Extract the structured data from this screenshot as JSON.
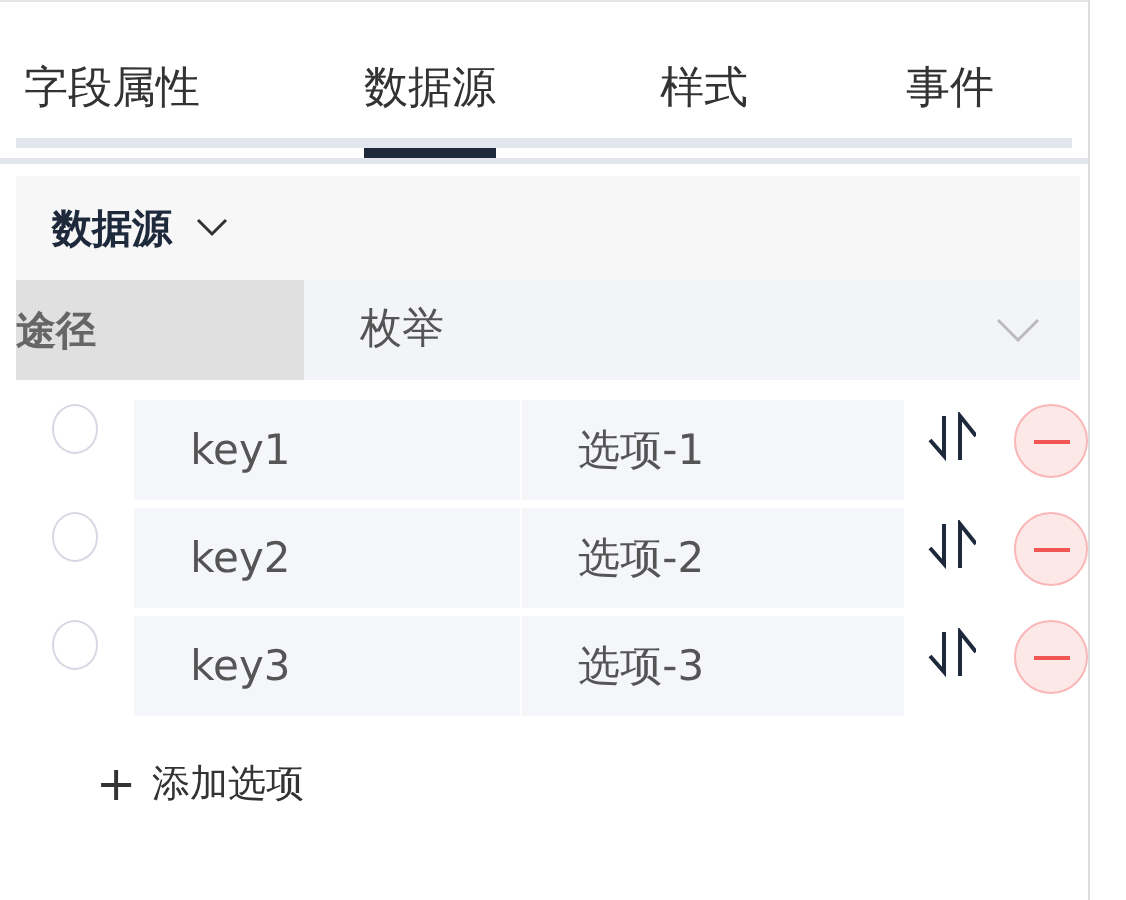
{
  "tabs": [
    {
      "label": "字段属性",
      "selected": false
    },
    {
      "label": "数据源",
      "selected": true
    },
    {
      "label": "样式",
      "selected": false
    },
    {
      "label": "事件",
      "selected": false
    }
  ],
  "section": {
    "title": "数据源",
    "expanded": true
  },
  "source": {
    "label": "途径",
    "value": "枚举"
  },
  "options": [
    {
      "key": "key1",
      "label": "选项-1",
      "selected": false
    },
    {
      "key": "key2",
      "label": "选项-2",
      "selected": false
    },
    {
      "key": "key3",
      "label": "选项-3",
      "selected": false
    }
  ],
  "add_option": {
    "icon": "+",
    "label": "添加选项"
  }
}
